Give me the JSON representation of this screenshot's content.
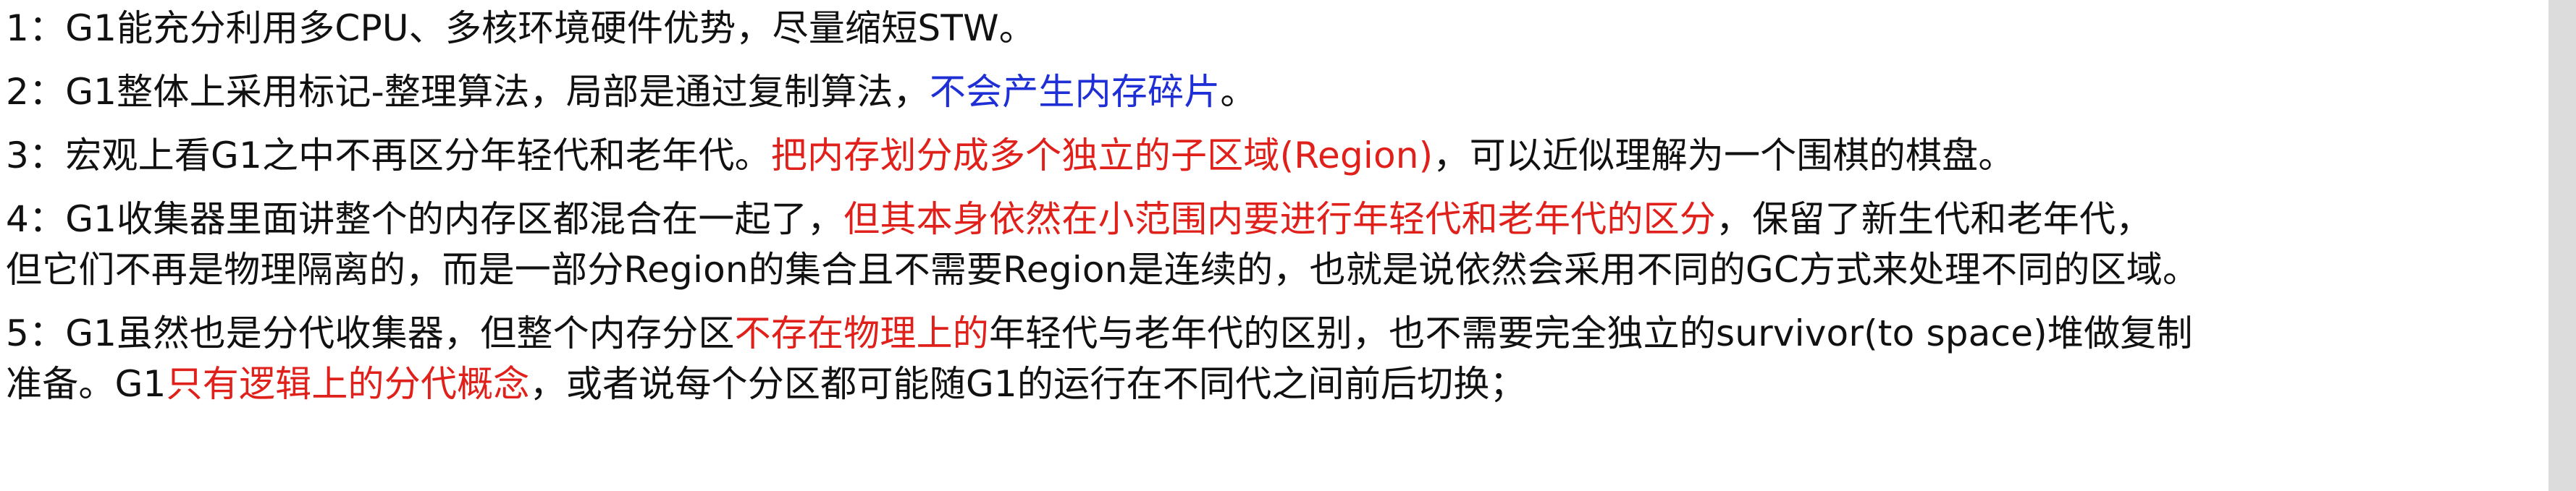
{
  "document": {
    "colors": {
      "text": "#111111",
      "red": "#e0201b",
      "blue": "#1f2fd6",
      "edge": "#dcdcdc"
    },
    "paragraphs": [
      {
        "lines": [
          [
            {
              "text": "1：G1能充分利用多CPU、多核环境硬件优势，尽量缩短STW。",
              "color": "default"
            }
          ]
        ]
      },
      {
        "lines": [
          [
            {
              "text": "2：G1整体上采用标记-整理算法，局部是通过复制算法，",
              "color": "default"
            },
            {
              "text": "不会产生内存碎片",
              "color": "blue"
            },
            {
              "text": "。",
              "color": "default"
            }
          ]
        ]
      },
      {
        "lines": [
          [
            {
              "text": "3：宏观上看G1之中不再区分年轻代和老年代。",
              "color": "default"
            },
            {
              "text": "把内存划分成多个独立的子区域(Region)",
              "color": "red"
            },
            {
              "text": "，可以近似理解为一个围棋的棋盘。",
              "color": "default"
            }
          ]
        ]
      },
      {
        "lines": [
          [
            {
              "text": "4：G1收集器里面讲整个的内存区都混合在一起了，",
              "color": "default"
            },
            {
              "text": "但其本身依然在小范围内要进行年轻代和老年代的区分",
              "color": "red"
            },
            {
              "text": "，保留了新生代和老年代，",
              "color": "default"
            }
          ],
          [
            {
              "text": "但它们不再是物理隔离的，而是一部分Region的集合且不需要Region是连续的，也就是说依然会采用不同的GC方式来处理不同的区域。",
              "color": "default"
            }
          ]
        ]
      },
      {
        "lines": [
          [
            {
              "text": "5：G1虽然也是分代收集器，但整个内存分区",
              "color": "default"
            },
            {
              "text": "不存在物理上的",
              "color": "red"
            },
            {
              "text": "年轻代与老年代的区别，也不需要完全独立的survivor(to space)堆做复制",
              "color": "default"
            }
          ],
          [
            {
              "text": "准备。G1",
              "color": "default"
            },
            {
              "text": "只有逻辑上的分代概念",
              "color": "red"
            },
            {
              "text": "，或者说每个分区都可能随G1的运行在不同代之间前后切换；",
              "color": "default"
            }
          ]
        ]
      }
    ]
  }
}
